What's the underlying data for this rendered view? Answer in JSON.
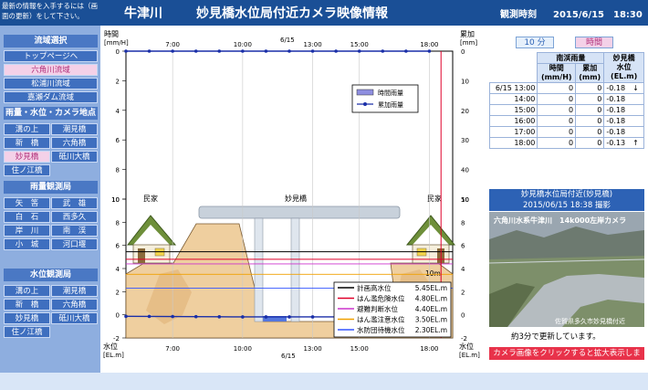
{
  "header": {
    "notice": "最新の情報を入手するには（画面の更新）をして下さい。",
    "river": "牛津川",
    "title": "妙見橋水位局付近カメラ映像情報",
    "time_label": "観測時刻",
    "time_value": "2015/6/15　18:30"
  },
  "nav": {
    "section1": "流域選択",
    "top": "トップページへ",
    "basins": [
      "六角川流域",
      "松浦川流域",
      "嘉瀬ダム流域"
    ],
    "section2": "雨量・水位・カメラ地点",
    "points": [
      "溝の上",
      "潮見橋",
      "新　橋",
      "六角橋",
      "妙見橋",
      "砥川大橋",
      "住ノ江橋"
    ],
    "section3": "雨量観測局",
    "rain": [
      "矢　筈",
      "武　雄",
      "白　石",
      "西多久",
      "岸　川",
      "南　渓",
      "小　城",
      "河口堰"
    ],
    "section4": "水位観測局",
    "water": [
      "溝の上",
      "潮見橋",
      "新　橋",
      "六角橋",
      "妙見橋",
      "砥川大橋",
      "住ノ江橋"
    ]
  },
  "chart": {
    "left_axis_label1": "時間",
    "left_axis_unit1": "[mm/H]",
    "right_axis_label1": "累加",
    "right_axis_unit1": "[mm]",
    "left_axis_label2": "水位",
    "left_axis_unit2": "[EL.m]",
    "right_axis_label2": "水位",
    "right_axis_unit2": "[EL.m]",
    "date_top": "6/15",
    "date_bottom": "6/15",
    "house_left": "民家",
    "house_right": "民家",
    "bridge": "妙見橋",
    "legend_rain": [
      "時間雨量",
      "累加雨量"
    ],
    "level_legend": [
      {
        "label": "計画高水位",
        "value": "5.45EL.m",
        "color": "#000000"
      },
      {
        "label": "はん濫危険水位",
        "value": "4.80EL.m",
        "color": "#e0002a"
      },
      {
        "label": "避難判断水位",
        "value": "4.40EL.m",
        "color": "#cc33cc"
      },
      {
        "label": "はん濫注意水位",
        "value": "3.50EL.m",
        "color": "#f0a000"
      },
      {
        "label": "水防団待機水位",
        "value": "2.30EL.m",
        "color": "#3355ff"
      }
    ],
    "ten_m_label": "10m",
    "colors": {
      "accent": "#1a4f96",
      "now_line": "#e0002a",
      "ground": "#e8c090",
      "water": "#5577dd"
    }
  },
  "chart_data": {
    "type": "line",
    "x_ticks": [
      "7:00",
      "10:00",
      "13:00",
      "15:00",
      "18:00"
    ],
    "rain_ticks_left": [
      0,
      2,
      4,
      6,
      8,
      10
    ],
    "rain_ticks_right": [
      0,
      10,
      20,
      30,
      40,
      50
    ],
    "level_ticks": [
      -2,
      0,
      2,
      4,
      6,
      8,
      10
    ],
    "series": [
      {
        "name": "累加雨量",
        "x": [
          "5:00",
          "6:00",
          "7:00",
          "8:00",
          "9:00",
          "10:00",
          "11:00",
          "12:00",
          "13:00",
          "14:00",
          "15:00",
          "16:00",
          "17:00",
          "18:00"
        ],
        "values": [
          0,
          0,
          0,
          0,
          0,
          0,
          0,
          0,
          0,
          0,
          0,
          0,
          0,
          0
        ]
      },
      {
        "name": "水位",
        "x": [
          "5:00",
          "6:00",
          "7:00",
          "8:00",
          "9:00",
          "10:00",
          "11:00",
          "12:00",
          "13:00",
          "14:00",
          "15:00",
          "16:00",
          "17:00",
          "18:00"
        ],
        "values": [
          -0.13,
          -0.14,
          -0.15,
          -0.16,
          -0.17,
          -0.18,
          -0.18,
          -0.18,
          -0.18,
          -0.18,
          -0.18,
          -0.18,
          -0.18,
          -0.13
        ]
      }
    ],
    "now": "18:30"
  },
  "right": {
    "btn_10min": "10 分",
    "btn_hour": "時間",
    "table_head": {
      "rain_group": "南渓雨量",
      "hourly": "時間",
      "hourly_unit": "(mm/H)",
      "cum": "累加",
      "cum_unit": "(mm)",
      "level": "妙見橋",
      "level2": "水位",
      "level_unit": "(EL.m)"
    },
    "rows": [
      {
        "time": "6/15 13:00",
        "hourly": "0",
        "cum": "0",
        "level": "-0.18",
        "arrow": "↓"
      },
      {
        "time": "14:00",
        "hourly": "0",
        "cum": "0",
        "level": "-0.18",
        "arrow": ""
      },
      {
        "time": "15:00",
        "hourly": "0",
        "cum": "0",
        "level": "-0.18",
        "arrow": ""
      },
      {
        "time": "16:00",
        "hourly": "0",
        "cum": "0",
        "level": "-0.18",
        "arrow": ""
      },
      {
        "time": "17:00",
        "hourly": "0",
        "cum": "0",
        "level": "-0.18",
        "arrow": ""
      },
      {
        "time": "18:00",
        "hourly": "0",
        "cum": "0",
        "level": "-0.13",
        "arrow": "↑"
      }
    ],
    "cam_title": "妙見橋水位局付近(妙見橋)",
    "cam_date": "2015/06/15 18:38 撮影",
    "cam_caption": "六角川水系牛津川　14k000左岸カメラ",
    "cam_credit": "佐賀県多久市妙見橋付近",
    "cam_note": "約3分で更新しています。",
    "enlarge": "カメラ画像をクリックすると拡大表示します。"
  }
}
